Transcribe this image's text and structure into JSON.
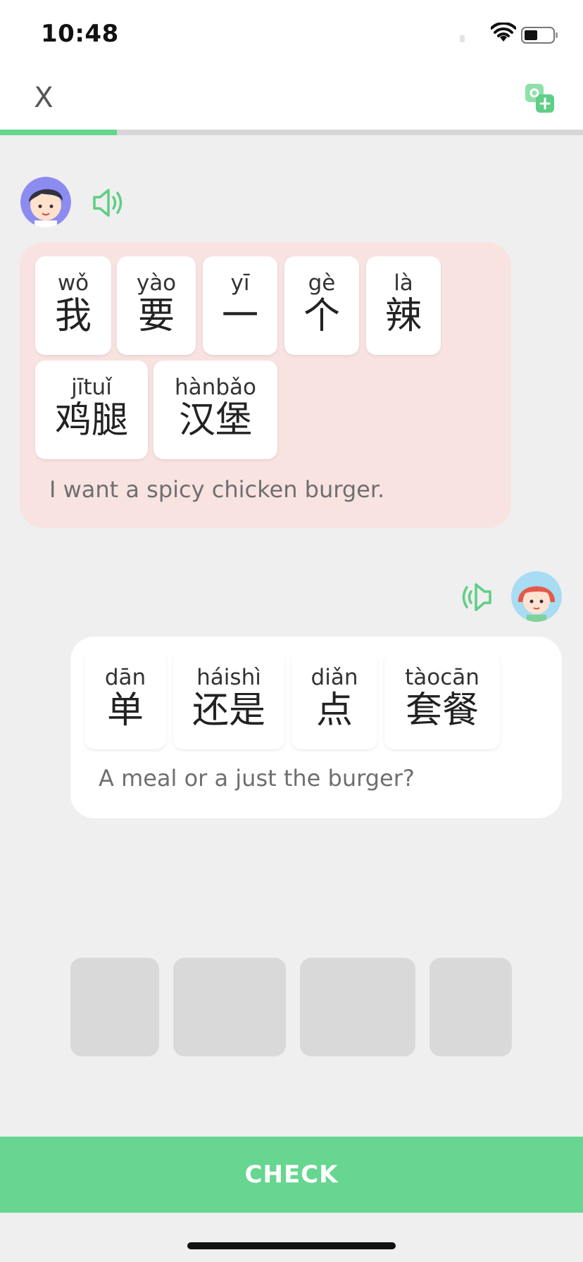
{
  "status_bar": {
    "time": "10:48"
  },
  "header": {
    "close_label": "X",
    "translate_icon": "translate-icon"
  },
  "progress": {
    "fraction": 0.2
  },
  "message1": {
    "speaker": "boy-avatar",
    "words": [
      {
        "pinyin": "wǒ",
        "hanzi": "我"
      },
      {
        "pinyin": "yào",
        "hanzi": "要"
      },
      {
        "pinyin": "yī",
        "hanzi": "一"
      },
      {
        "pinyin": "gè",
        "hanzi": "个"
      },
      {
        "pinyin": "là",
        "hanzi": "辣"
      },
      {
        "pinyin": "jītuǐ",
        "hanzi": "鸡腿"
      },
      {
        "pinyin": "hànbǎo",
        "hanzi": "汉堡"
      }
    ],
    "translation": "I want a spicy chicken burger."
  },
  "message2": {
    "speaker": "girl-avatar",
    "words": [
      {
        "pinyin": "dān",
        "hanzi": "单"
      },
      {
        "pinyin": "háishì",
        "hanzi": "还是"
      },
      {
        "pinyin": "diǎn",
        "hanzi": "点"
      },
      {
        "pinyin": "tàocān",
        "hanzi": "套餐"
      }
    ],
    "translation": "A meal or a just the burger?"
  },
  "answer_slots_count": 4,
  "check_label": "CHECK",
  "colors": {
    "accent": "#66d690",
    "bubble_left": "#f8e3e1",
    "bubble_right": "#ffffff",
    "background": "#efefef",
    "slot": "#d9d9d9"
  }
}
